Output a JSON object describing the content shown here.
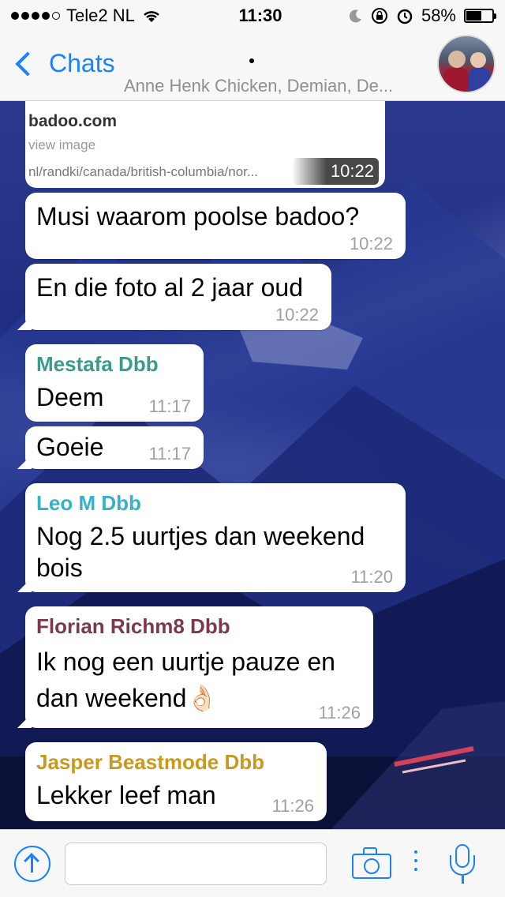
{
  "status_bar": {
    "carrier": "Tele2 NL",
    "time": "11:30",
    "battery_percent": "58%",
    "battery_level": 0.58,
    "icons": [
      "signal-dots",
      "wifi-icon",
      "moon-icon",
      "rotation-lock-icon",
      "alarm-icon",
      "battery-icon"
    ]
  },
  "nav": {
    "back_label": "Chats",
    "subtitle": "Anne Henk Chicken, Demian, De..."
  },
  "link_card": {
    "domain": "badoo.com",
    "view_label": "view image",
    "url": "nl/randki/canada/british-columbia/nor...",
    "time": "10:22"
  },
  "messages": [
    {
      "sender": "",
      "text": "Musi waarom poolse badoo?",
      "time": "10:22"
    },
    {
      "sender": "",
      "text": "En die foto al 2 jaar oud",
      "time": "10:22"
    },
    {
      "sender": "Mestafa Dbb",
      "sender_color": "#3a9a8c",
      "text": "Deem",
      "time": "11:17"
    },
    {
      "sender": "",
      "text": "Goeie",
      "time": "11:17"
    },
    {
      "sender": "Leo M Dbb",
      "sender_color": "#35b1c8",
      "text": "Nog 2.5 uurtjes dan weekend bois",
      "time": "11:20"
    },
    {
      "sender": "Florian Richm8 Dbb",
      "sender_color": "#7b3a4a",
      "text": "Ik nog een uurtje pauze en dan weekend👌🏻",
      "time": "11:26"
    },
    {
      "sender": "Jasper Beastmode Dbb",
      "sender_color": "#c79a1e",
      "text": "Lekker leef man",
      "time": "11:26"
    }
  ],
  "input": {
    "placeholder": "",
    "value": ""
  },
  "colors": {
    "accent": "#1a82fb",
    "bar_background": "#f7f7f7"
  }
}
